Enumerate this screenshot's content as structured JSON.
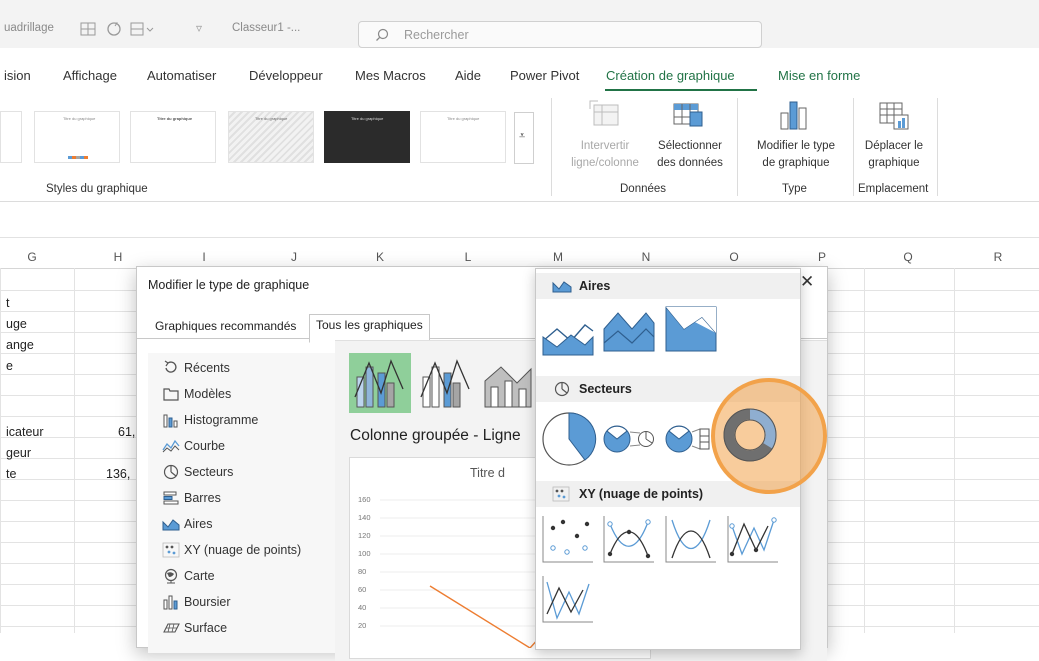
{
  "title_bar": {
    "quick_access_partial": "uadrillage",
    "document_title": "Classeur1  -...",
    "search_placeholder": "Rechercher"
  },
  "ribbon_tabs": [
    {
      "label": "ision"
    },
    {
      "label": "Affichage"
    },
    {
      "label": "Automatiser"
    },
    {
      "label": "Développeur"
    },
    {
      "label": "Mes Macros"
    },
    {
      "label": "Aide"
    },
    {
      "label": "Power Pivot"
    },
    {
      "label": "Création de graphique",
      "active": true
    },
    {
      "label": "Mise en forme"
    }
  ],
  "ribbon": {
    "chart_styles_label": "Styles du graphique",
    "style_thumbs": [
      "Titre du graphique",
      "Titre du graphique",
      "Titre du graphique",
      "Titre du graphique",
      "Titre du graphique"
    ],
    "switch_row_col": {
      "line1": "Intervertir",
      "line2": "ligne/colonne"
    },
    "select_data": {
      "line1": "Sélectionner",
      "line2": "des données"
    },
    "data_group_label": "Données",
    "change_type": {
      "line1": "Modifier le type",
      "line2": "de graphique"
    },
    "type_group_label": "Type",
    "move_chart": {
      "line1": "Déplacer le",
      "line2": "graphique"
    },
    "location_group_label": "Emplacement"
  },
  "grid": {
    "columns": [
      "G",
      "H",
      "I",
      "J",
      "K",
      "L",
      "M",
      "N",
      "O",
      "P",
      "Q",
      "R"
    ],
    "cells": [
      {
        "text": "t"
      },
      {
        "text": "uge"
      },
      {
        "text": "ange"
      },
      {
        "text": "e"
      },
      {
        "text": "icateur"
      },
      {
        "text": "61,"
      },
      {
        "text": "geur"
      },
      {
        "text": "te"
      },
      {
        "text": "136,"
      }
    ]
  },
  "dialog": {
    "title": "Modifier le type de graphique",
    "close_glyph": "✕",
    "tabs": [
      "Graphiques recommandés",
      "Tous les graphiques"
    ],
    "categories": [
      "Récents",
      "Modèles",
      "Histogramme",
      "Courbe",
      "Secteurs",
      "Barres",
      "Aires",
      "XY (nuage de points)",
      "Carte",
      "Boursier",
      "Surface"
    ],
    "combo_title": "Colonne groupée - Ligne",
    "preview_title": "Titre d",
    "preview_yticks": [
      "160",
      "140",
      "120",
      "100",
      "80",
      "60",
      "40",
      "20"
    ]
  },
  "gallery": {
    "sections": [
      "Aires",
      "Secteurs",
      "XY (nuage de points)"
    ]
  },
  "colors": {
    "accent_green": "#217346",
    "chart_blue": "#5b9bd5",
    "highlight_orange": "#f2a24a"
  }
}
